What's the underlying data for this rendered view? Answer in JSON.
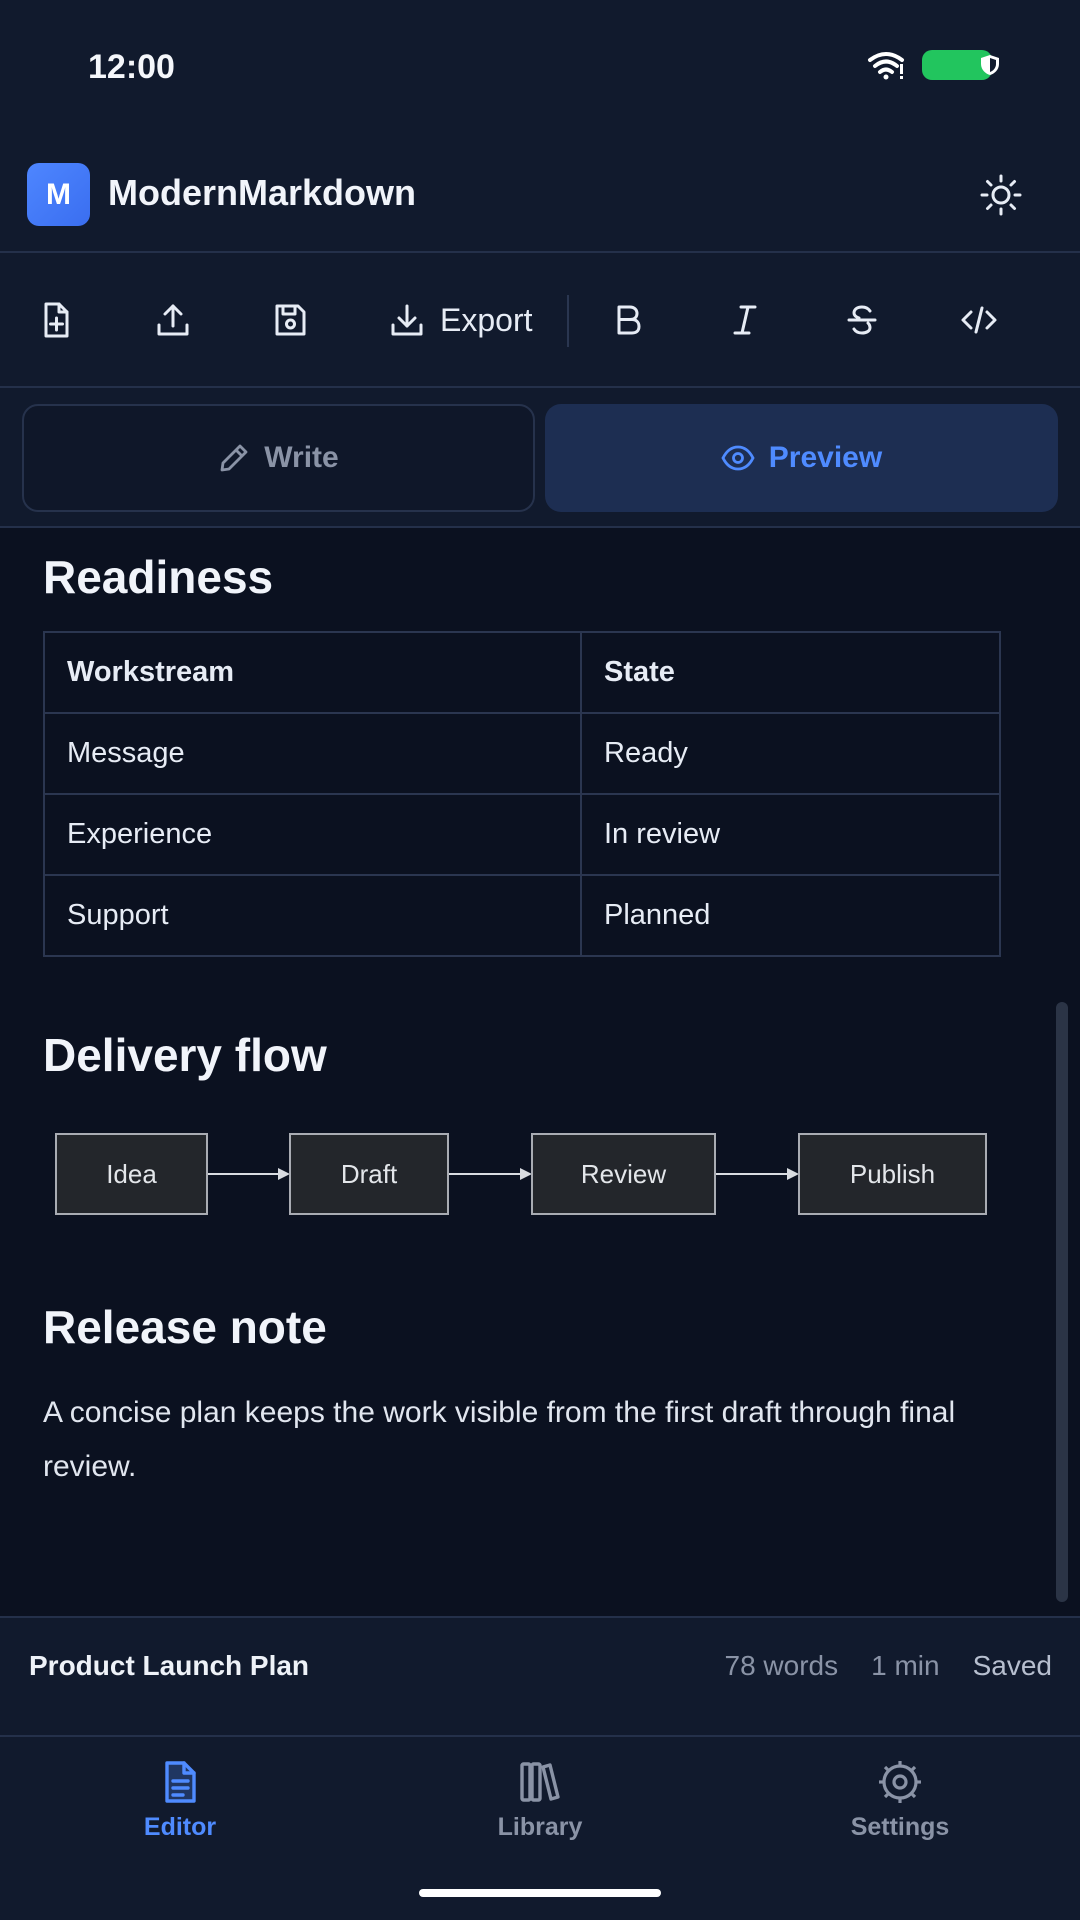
{
  "status_bar": {
    "time": "12:00",
    "icons": [
      "wifi-icon",
      "battery-icon",
      "shield-icon"
    ]
  },
  "header": {
    "logo_letter": "M",
    "title": "ModernMarkdown",
    "theme_icon": "sun-icon"
  },
  "toolbar": {
    "buttons": [
      "new-file-icon",
      "upload-icon",
      "save-icon",
      "export-icon",
      "bold-icon",
      "italic-icon",
      "strikethrough-icon",
      "code-icon"
    ],
    "export_label": "Export"
  },
  "view_toggle": {
    "write_label": "Write",
    "preview_label": "Preview",
    "active": "Preview"
  },
  "preview": {
    "readiness_heading": "Readiness",
    "table": {
      "headers": [
        "Workstream",
        "State"
      ],
      "rows": [
        [
          "Message",
          "Ready"
        ],
        [
          "Experience",
          "In review"
        ],
        [
          "Support",
          "Planned"
        ]
      ]
    },
    "flow_heading": "Delivery flow",
    "flow_nodes": [
      "Idea",
      "Draft",
      "Review",
      "Publish"
    ],
    "release_heading": "Release note",
    "release_text": "A concise plan keeps the work visible from the first draft through final review."
  },
  "doc_footer": {
    "doc_name": "Product Launch Plan",
    "word_count": "78 words",
    "read_time": "1 min",
    "save_status": "Saved"
  },
  "bottom_nav": {
    "items": [
      {
        "label": "Editor",
        "icon": "document-icon",
        "active": true
      },
      {
        "label": "Library",
        "icon": "library-icon",
        "active": false
      },
      {
        "label": "Settings",
        "icon": "gear-icon",
        "active": false
      }
    ]
  },
  "colors": {
    "accent": "#4f8bff",
    "background": "#0b1120",
    "surface": "#111a2d",
    "battery": "#22c55e"
  }
}
